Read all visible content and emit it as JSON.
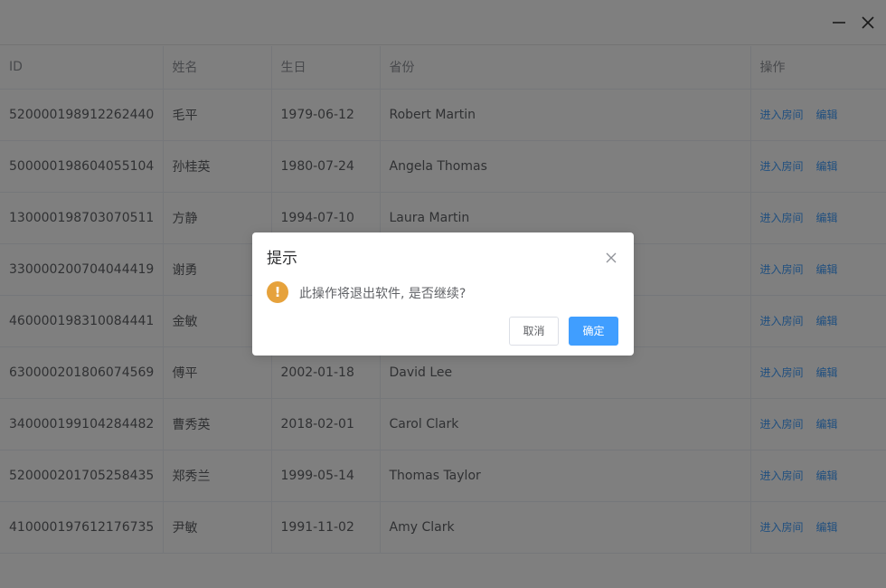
{
  "window": {
    "minimize_icon": "minus-icon",
    "close_icon": "close-icon"
  },
  "table": {
    "columns": [
      "ID",
      "姓名",
      "生日",
      "省份",
      "操作"
    ],
    "rows": [
      {
        "id": "520000198912262440",
        "name": "毛平",
        "birthday": "1979-06-12",
        "province": "Robert Martin"
      },
      {
        "id": "500000198604055104",
        "name": "孙桂英",
        "birthday": "1980-07-24",
        "province": "Angela Thomas"
      },
      {
        "id": "130000198703070511",
        "name": "方静",
        "birthday": "1994-07-10",
        "province": "Laura Martin"
      },
      {
        "id": "330000200704044419",
        "name": "谢勇",
        "birthday": "",
        "province": ""
      },
      {
        "id": "460000198310084441",
        "name": "金敏",
        "birthday": "",
        "province": ""
      },
      {
        "id": "630000201806074569",
        "name": "傅平",
        "birthday": "2002-01-18",
        "province": "David Lee"
      },
      {
        "id": "340000199104284482",
        "name": "曹秀英",
        "birthday": "2018-02-01",
        "province": "Carol Clark"
      },
      {
        "id": "520000201705258435",
        "name": "郑秀兰",
        "birthday": "1999-05-14",
        "province": "Thomas Taylor"
      },
      {
        "id": "410000197612176735",
        "name": "尹敏",
        "birthday": "1991-11-02",
        "province": "Amy Clark"
      }
    ],
    "actions": {
      "enter_room": "进入房间",
      "edit": "编辑"
    },
    "link_color": "#409eff"
  },
  "dialog": {
    "title": "提示",
    "message": "此操作将退出软件, 是否继续?",
    "warning_icon": "exclamation-icon",
    "warning_glyph": "!",
    "warning_color": "#e6a23c",
    "close_icon": "close-icon",
    "cancel_label": "取消",
    "confirm_label": "确定",
    "confirm_color": "#409eff"
  }
}
